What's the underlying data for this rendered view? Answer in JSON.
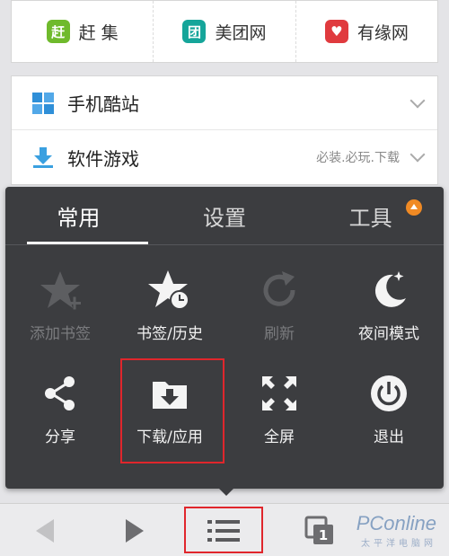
{
  "sites": [
    {
      "badge": "赶",
      "label": "赶 集",
      "color": "#6fba2c"
    },
    {
      "badge": "团",
      "label": "美团网",
      "color": "#15a59a"
    },
    {
      "badge": "♥",
      "label": "有缘网",
      "color": "#e03a3e"
    }
  ],
  "categories": [
    {
      "title": "手机酷站",
      "note": "",
      "icon": "grid-icon"
    },
    {
      "title": "软件游戏",
      "note": "必装.必玩.下载",
      "icon": "download-arrow-icon"
    }
  ],
  "menu": {
    "tabs": [
      {
        "label": "常用",
        "active": true
      },
      {
        "label": "设置",
        "active": false
      },
      {
        "label": "工具",
        "active": false,
        "badge": "update"
      }
    ],
    "items": [
      {
        "label": "添加书签",
        "icon": "add-bookmark-star-icon",
        "disabled": true
      },
      {
        "label": "书签/历史",
        "icon": "bookmark-history-icon",
        "disabled": false
      },
      {
        "label": "刷新",
        "icon": "refresh-icon",
        "disabled": true
      },
      {
        "label": "夜间模式",
        "icon": "moon-icon",
        "disabled": false
      },
      {
        "label": "分享",
        "icon": "share-icon",
        "disabled": false
      },
      {
        "label": "下载/应用",
        "icon": "download-folder-icon",
        "disabled": false
      },
      {
        "label": "全屏",
        "icon": "fullscreen-icon",
        "disabled": false
      },
      {
        "label": "退出",
        "icon": "power-icon",
        "disabled": false
      }
    ]
  },
  "toolbar": {
    "back_icon": "back-arrow-icon",
    "forward_icon": "forward-arrow-icon",
    "menu_icon": "menu-list-icon",
    "tabs_icon": "tabs-icon",
    "tabs_count": "1"
  },
  "watermark": {
    "main": "PConline",
    "sub": "太平洋电脑网"
  },
  "colors": {
    "accent_highlight": "#e0262c",
    "menu_bg": "#3c3d40",
    "badge_orange": "#f08a24"
  }
}
